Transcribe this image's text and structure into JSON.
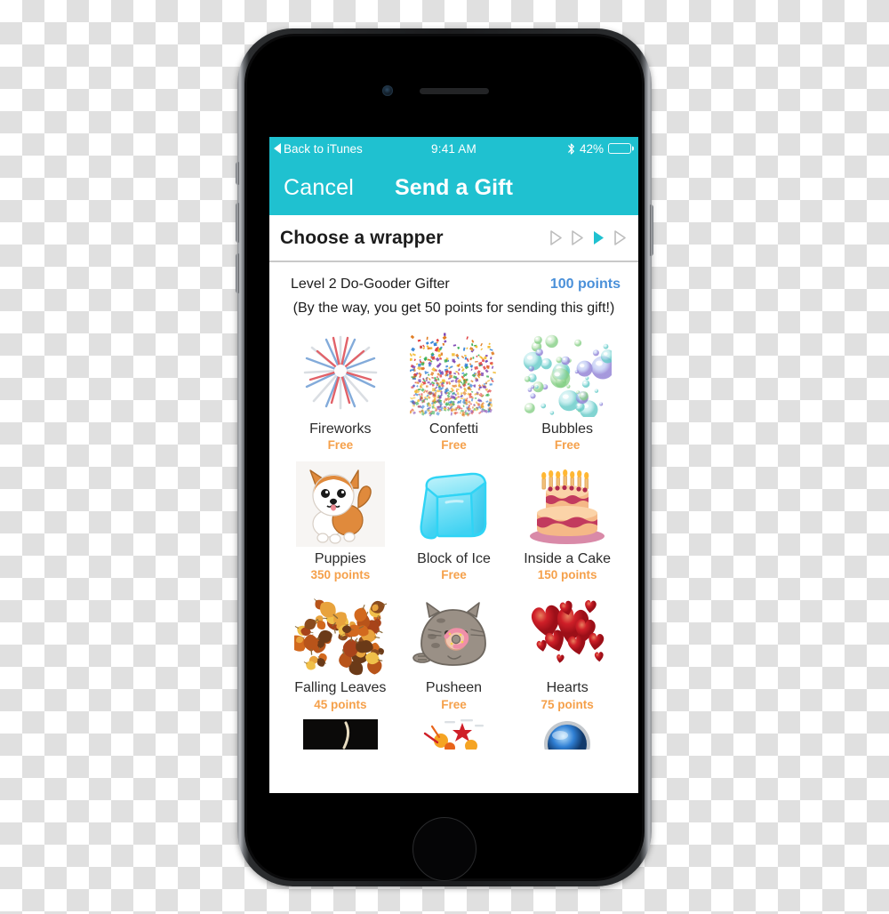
{
  "status_bar": {
    "back_label": "Back to iTunes",
    "back_icon": "left-caret-icon",
    "time": "9:41 AM",
    "bluetooth_icon": "bluetooth-icon",
    "battery_percent": "42%",
    "battery_level": 42
  },
  "nav_bar": {
    "cancel_label": "Cancel",
    "title": "Send a Gift"
  },
  "section": {
    "title": "Choose a wrapper",
    "steps": [
      {
        "name": "step-1",
        "active": false
      },
      {
        "name": "step-2",
        "active": false
      },
      {
        "name": "step-3",
        "active": true
      },
      {
        "name": "step-4",
        "active": false
      }
    ]
  },
  "level": {
    "label": "Level 2 Do-Gooder Gifter",
    "points": "100 points",
    "note": "(By the way, you get 50 points for sending this gift!)"
  },
  "wrappers": [
    {
      "name": "Fireworks",
      "price": "Free",
      "icon": "fireworks-icon"
    },
    {
      "name": "Confetti",
      "price": "Free",
      "icon": "confetti-icon"
    },
    {
      "name": "Bubbles",
      "price": "Free",
      "icon": "bubbles-icon"
    },
    {
      "name": "Puppies",
      "price": "350 points",
      "icon": "puppy-icon"
    },
    {
      "name": "Block of Ice",
      "price": "Free",
      "icon": "ice-block-icon"
    },
    {
      "name": "Inside a Cake",
      "price": "150 points",
      "icon": "cake-icon"
    },
    {
      "name": "Falling Leaves",
      "price": "45 points",
      "icon": "leaves-icon"
    },
    {
      "name": "Pusheen",
      "price": "Free",
      "icon": "pusheen-cat-icon"
    },
    {
      "name": "Hearts",
      "price": "75 points",
      "icon": "hearts-icon"
    }
  ],
  "wrappers_partial": [
    {
      "name": "",
      "price": "",
      "icon": "dark-photo-icon"
    },
    {
      "name": "",
      "price": "",
      "icon": "explosion-stars-icon"
    },
    {
      "name": "",
      "price": "",
      "icon": "crystal-ball-icon"
    }
  ],
  "colors": {
    "accent_teal": "#1FC1D0",
    "price_orange": "#F5A04A",
    "points_blue": "#4A90D9"
  }
}
